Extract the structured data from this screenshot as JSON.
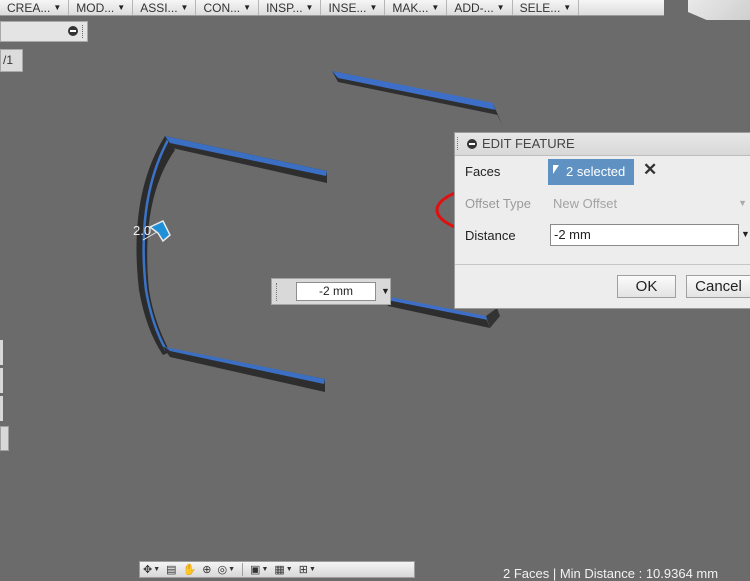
{
  "toolbar": {
    "items": [
      "CREA...",
      "MOD...",
      "ASSI...",
      "CON...",
      "INSP...",
      "INSE...",
      "MAK...",
      "ADD-...",
      "SELE..."
    ]
  },
  "browser": {
    "component_tab": "/1"
  },
  "viewport": {
    "dimension_label": "2.0",
    "inline_distance": "-2 mm"
  },
  "dialog": {
    "title": "EDIT FEATURE",
    "faces_label": "Faces",
    "faces_value": "2 selected",
    "offset_type_label": "Offset Type",
    "offset_type_value": "New Offset",
    "distance_label": "Distance",
    "distance_value": "-2 mm",
    "ok_label": "OK",
    "cancel_label": "Cancel"
  },
  "status_bar": {
    "text": "2 Faces | Min Distance : 10.9364 mm"
  },
  "colors": {
    "viewport_bg": "#6b6b6b",
    "selected_face": "#3a6fc4",
    "dialog_selected": "#5f92c2",
    "annotation_ring": "#e01010"
  }
}
